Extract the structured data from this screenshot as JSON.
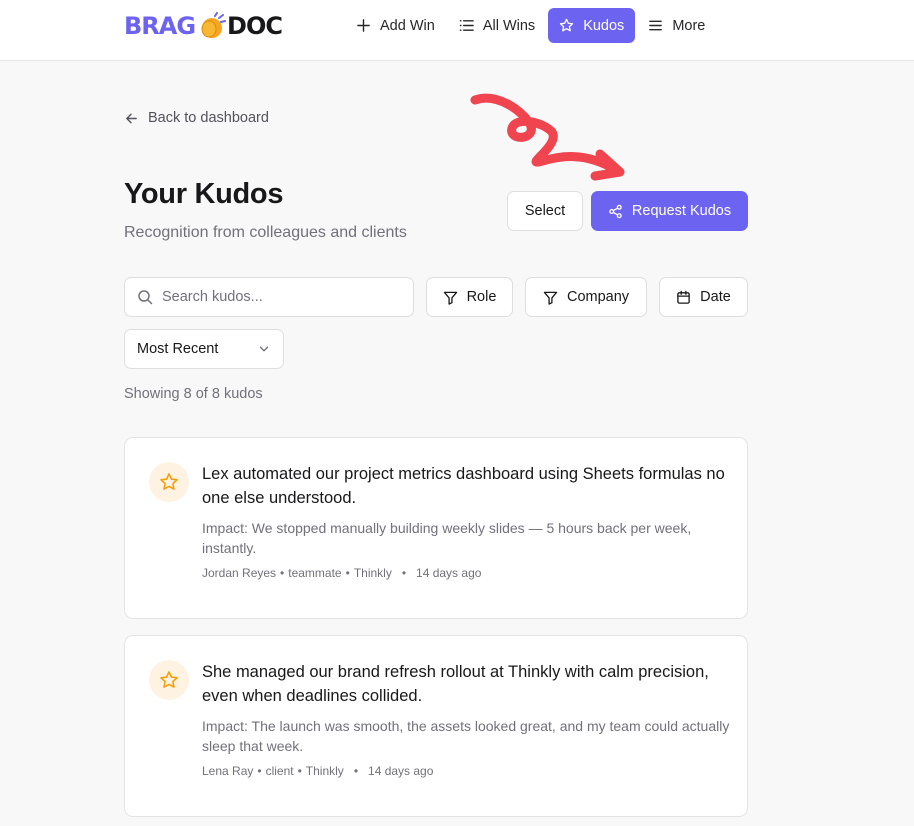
{
  "brand": {
    "part1": "BRAG",
    "part2": "DOC",
    "accent": "#6c63f0"
  },
  "nav": {
    "add_win": "Add Win",
    "all_wins": "All Wins",
    "kudos": "Kudos",
    "more": "More"
  },
  "back_link": "Back to dashboard",
  "page": {
    "title": "Your Kudos",
    "subtitle": "Recognition from colleagues and clients"
  },
  "actions": {
    "select": "Select",
    "request": "Request Kudos"
  },
  "filters": {
    "search_placeholder": "Search kudos...",
    "role": "Role",
    "company": "Company",
    "date": "Date",
    "sort": "Most Recent"
  },
  "count_text": "Showing 8 of 8 kudos",
  "kudos": [
    {
      "quote": "Lex automated our project metrics dashboard using Sheets formulas no one else understood.",
      "impact": "Impact: We stopped manually building weekly slides — 5 hours back per week, instantly.",
      "author": "Jordan Reyes",
      "role": "teammate",
      "company": "Thinkly",
      "time": "14 days ago"
    },
    {
      "quote": "She managed our brand refresh rollout at Thinkly with calm precision, even when deadlines collided.",
      "impact": "Impact: The launch was smooth, the assets looked great, and my team could actually sleep that week.",
      "author": "Lena Ray",
      "role": "client",
      "company": "Thinkly",
      "time": "14 days ago"
    }
  ]
}
